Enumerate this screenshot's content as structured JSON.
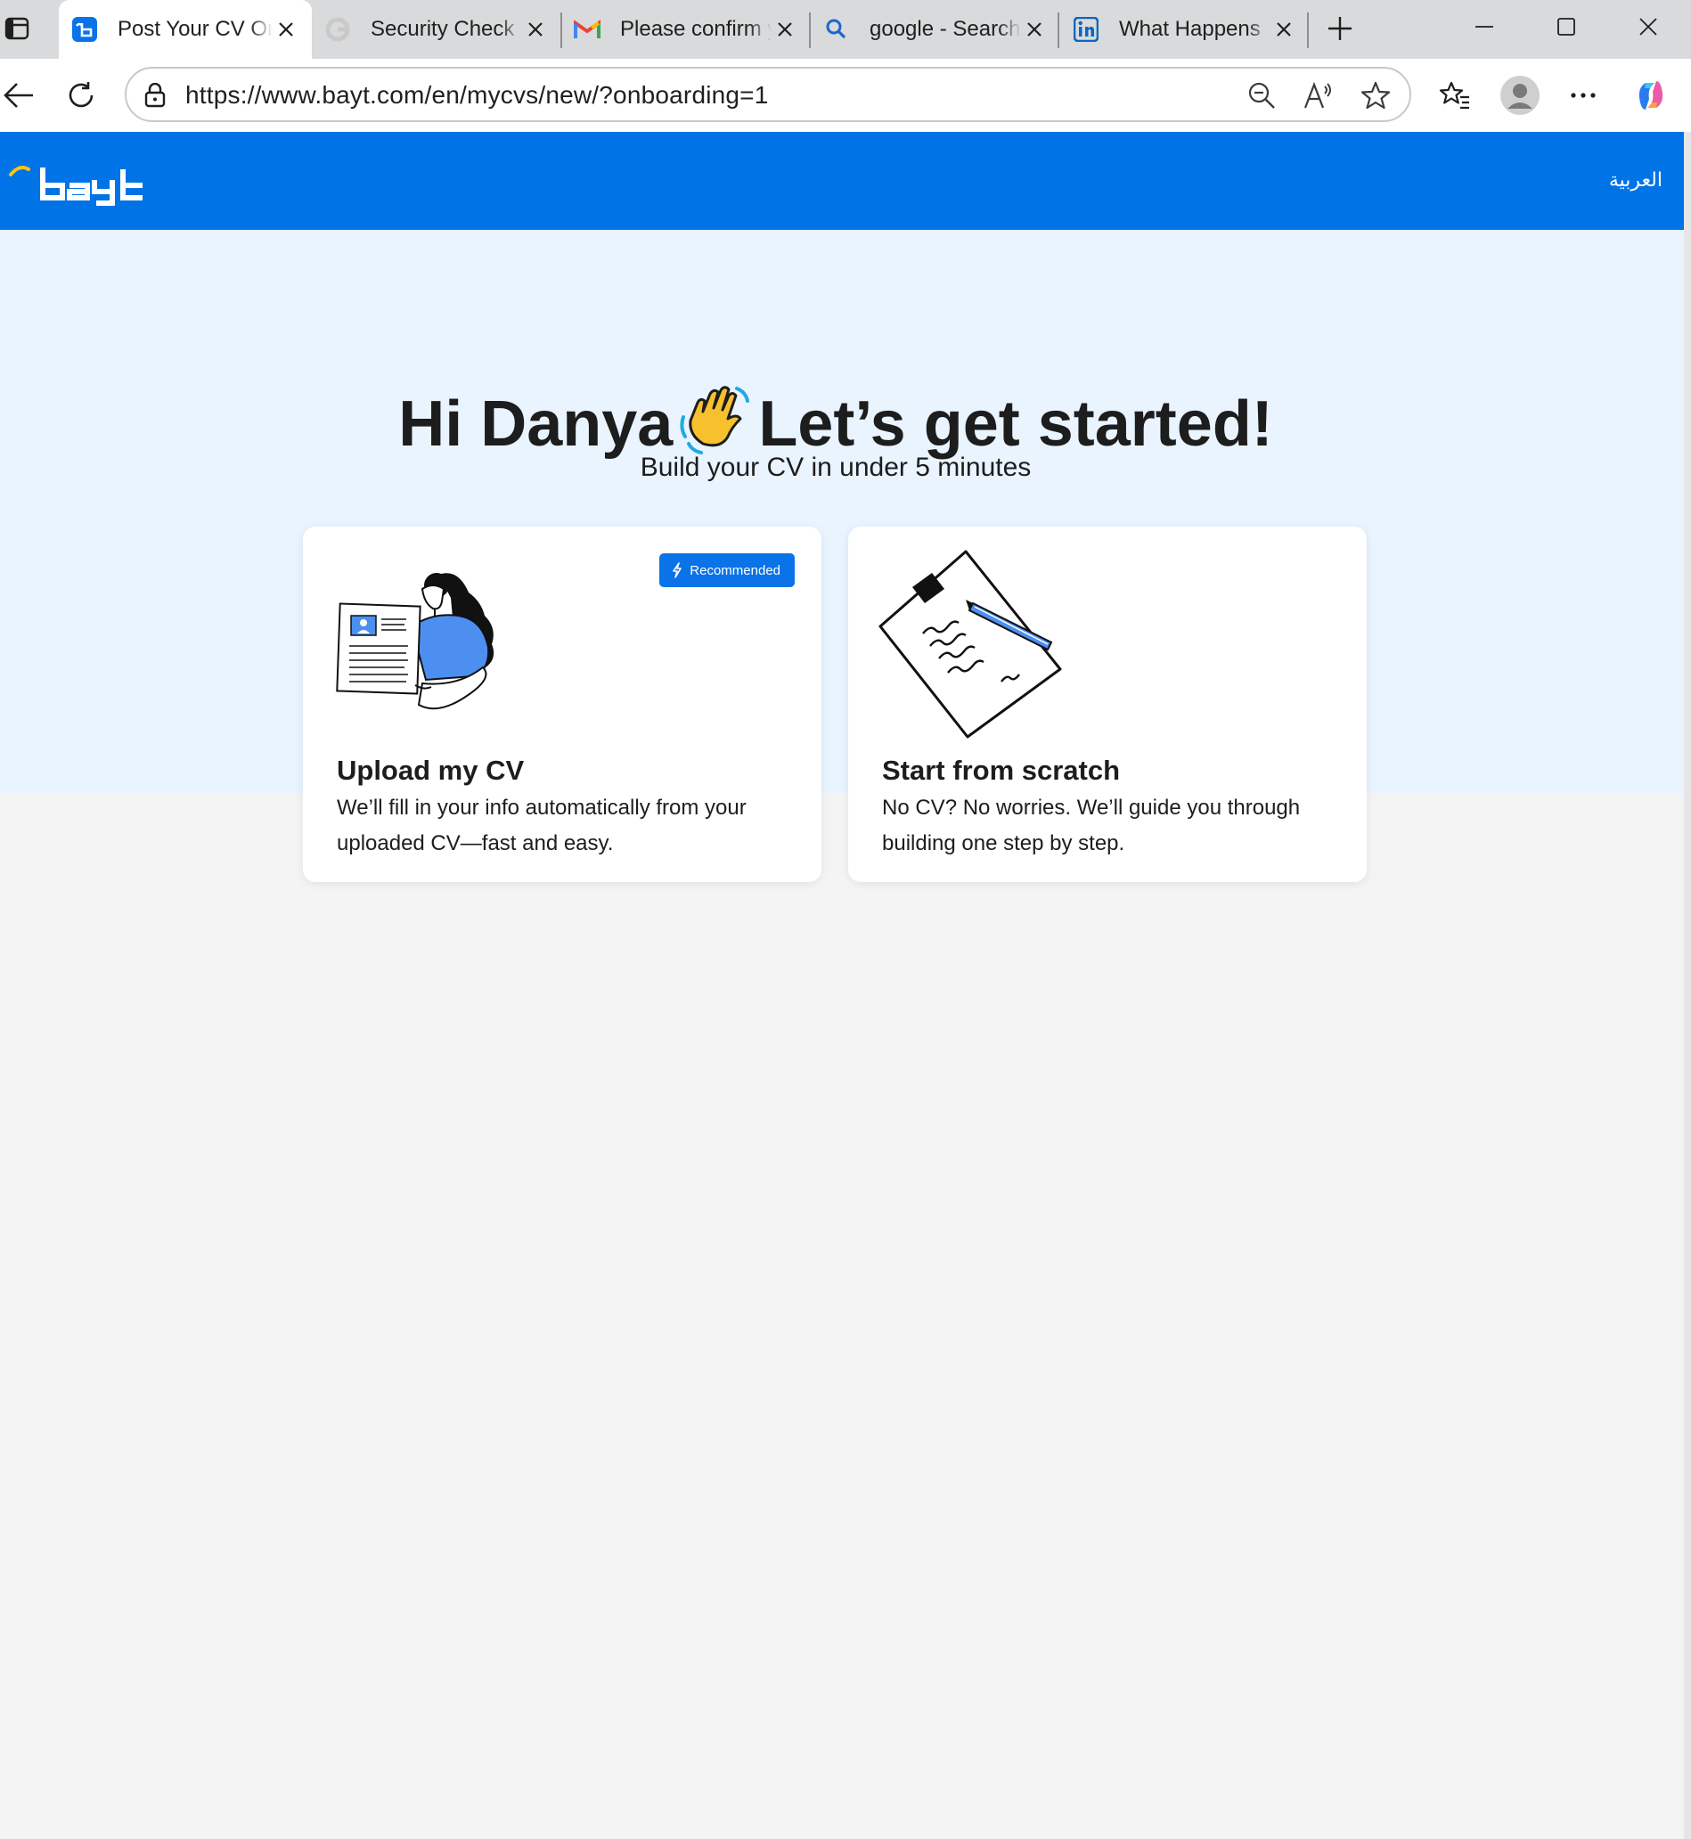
{
  "browser": {
    "tabs": [
      {
        "title": "Post Your CV Online | Bayt.com",
        "favicon": "bayt-icon",
        "active": true
      },
      {
        "title": "Security Check",
        "favicon": "google-icon",
        "active": false
      },
      {
        "title": "Please confirm your email",
        "favicon": "gmail-icon",
        "active": false
      },
      {
        "title": "google - Search",
        "favicon": "search-icon",
        "active": false
      },
      {
        "title": "What Happens",
        "favicon": "linkedin-icon",
        "active": false
      }
    ],
    "url": "https://www.bayt.com/en/mycvs/new/?onboarding=1"
  },
  "site": {
    "logo_text": "bayt",
    "language_link": "العربية",
    "brand_color": "#0073e6"
  },
  "hero": {
    "greeting": "Hi Danya",
    "headline_rest": "Let’s get started!",
    "subtitle": "Build your CV in under 5 minutes"
  },
  "options": [
    {
      "title": "Upload my CV",
      "description": "We’ll fill in your info automatically from your uploaded CV—fast and easy.",
      "badge": "Recommended"
    },
    {
      "title": "Start from scratch",
      "description": "No CV? No worries. We’ll guide you through building one step by step."
    }
  ]
}
